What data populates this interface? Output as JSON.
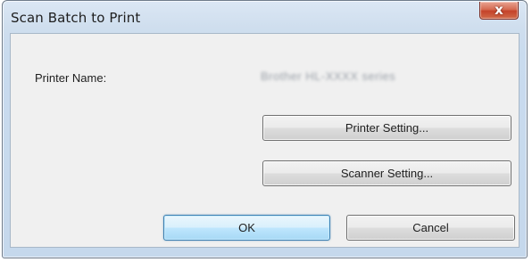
{
  "window": {
    "title": "Scan Batch to Print",
    "close_label": "x"
  },
  "printer": {
    "name_label": "Printer Name:",
    "name_value": "Brother HL-XXXX series"
  },
  "buttons": {
    "printer_setting": "Printer Setting...",
    "scanner_setting": "Scanner Setting...",
    "ok": "OK",
    "cancel": "Cancel"
  },
  "colors": {
    "frame": "#c9dbee",
    "client": "#f0f0f0",
    "close_button": "#c4432a",
    "default_button_border": "#3c7fb1"
  }
}
